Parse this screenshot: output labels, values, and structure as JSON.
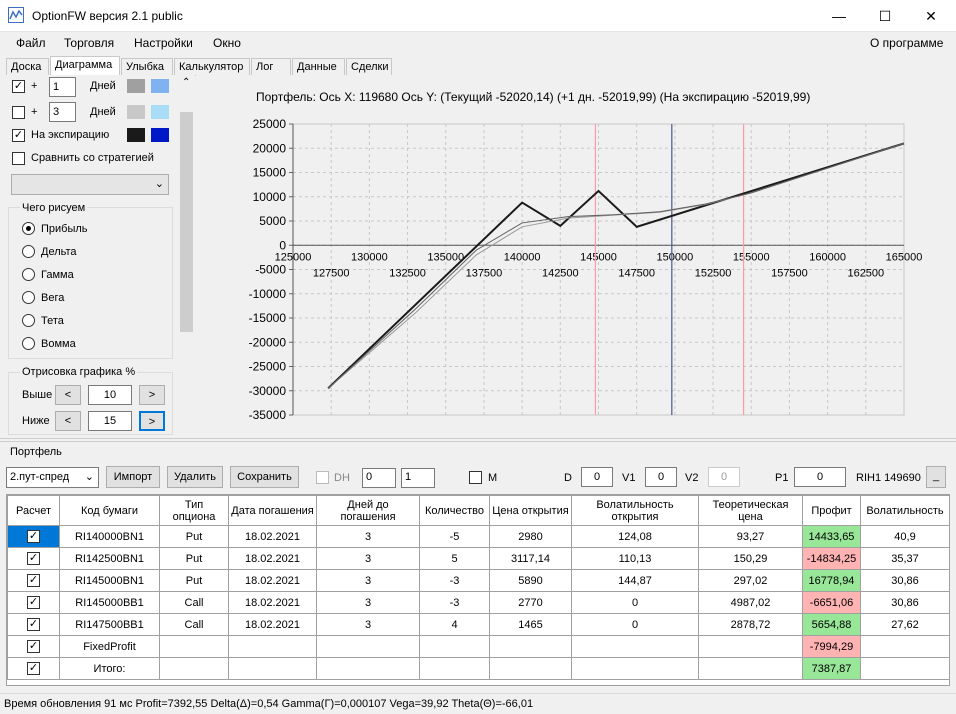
{
  "window": {
    "title": "OptionFW версия 2.1 public",
    "minimize": "—",
    "maximize": "☐",
    "close": "✕"
  },
  "menu": {
    "items": [
      "Файл",
      "Торговля",
      "Настройки",
      "Окно"
    ],
    "about": "О программе"
  },
  "tabs": [
    "Доска",
    "Диаграмма",
    "Улыбка",
    "Калькулятор",
    "Лог",
    "Данные",
    "Сделки"
  ],
  "active_tab": "Диаграмма",
  "left": {
    "row1": {
      "checked": true,
      "plus": "+",
      "days": "1",
      "days_label": "Дней",
      "colors": [
        "#a0a0a0",
        "#7eb2f0"
      ]
    },
    "row2": {
      "checked": false,
      "plus": "+",
      "days": "3",
      "days_label": "Дней",
      "colors": [
        "#c8c8c8",
        "#a8dcf7"
      ]
    },
    "row3": {
      "checked": true,
      "label": "На экспирацию",
      "colors": [
        "#1a1a1a",
        "#0018c8"
      ]
    },
    "compare": {
      "checked": false,
      "label": "Сравнить со стратегией"
    },
    "what_to_draw": {
      "title": "Чего рисуем",
      "options": [
        "Прибыль",
        "Дельта",
        "Гамма",
        "Вега",
        "Тета",
        "Вомма"
      ],
      "selected": "Прибыль"
    },
    "render": {
      "title": "Отрисовка графика %",
      "above_label": "Выше",
      "above_value": "10",
      "below_label": "Ниже",
      "below_value": "15"
    }
  },
  "chart": {
    "header": "Портфель:  Ось X:  119680  Ось Y:   (Текущий -52020,14)   (+1 дн.  -52019,99)   (На экспирацию -52019,99)"
  },
  "chart_data": {
    "type": "line",
    "y_ticks": [
      "25000",
      "20000",
      "15000",
      "10000",
      "5000",
      "0",
      "-5000",
      "-10000",
      "-15000",
      "-20000",
      "-25000",
      "-30000",
      "-35000"
    ],
    "x_ticks_top": [
      "125000",
      "130000",
      "135000",
      "140000",
      "145000",
      "150000",
      "155000",
      "160000",
      "165000"
    ],
    "x_ticks_bottom": [
      "127500",
      "132500",
      "137500",
      "142500",
      "147500",
      "152500",
      "157500",
      "162500"
    ],
    "xlim": [
      125000,
      165000
    ],
    "ylim": [
      -35000,
      25000
    ],
    "grid": true,
    "vlines": [
      {
        "x": 144800,
        "color": "#ff9aa8"
      },
      {
        "x": 149800,
        "color": "#4a5a8a"
      },
      {
        "x": 154500,
        "color": "#ff9aa8"
      }
    ],
    "series": [
      {
        "color": "#1a1a1a",
        "width": 2,
        "x": [
          127300,
          140000,
          142500,
          145000,
          147500,
          165000
        ],
        "y": [
          -29500,
          8800,
          4000,
          11200,
          3800,
          21000
        ]
      },
      {
        "color": "#9a9a9a",
        "width": 1,
        "x": [
          127300,
          133000,
          137000,
          140000,
          143000,
          146000,
          149000,
          152000,
          155000,
          165000
        ],
        "y": [
          -29500,
          -14000,
          -2000,
          3800,
          5600,
          6200,
          6800,
          8400,
          10800,
          21000
        ]
      },
      {
        "color": "#606060",
        "width": 1,
        "x": [
          127300,
          133000,
          137000,
          140000,
          143000,
          146000,
          149000,
          152000,
          155000,
          165000
        ],
        "y": [
          -29500,
          -13200,
          -1000,
          4600,
          5900,
          6300,
          6900,
          8500,
          10800,
          21000
        ]
      }
    ]
  },
  "portfolio": {
    "label": "Портфель",
    "strategy": "2.пут-спред",
    "import": "Импорт",
    "delete": "Удалить",
    "save": "Сохранить",
    "dh_label": "DH",
    "dh1": "0",
    "dh2": "1",
    "m_label": "M",
    "d_label": "D",
    "d_value": "0",
    "v1_label": "V1",
    "v1_value": "0",
    "v2_label": "V2",
    "v2_value": "0",
    "p1_label": "P1",
    "p1_value": "0",
    "instrument": "RIH1 149690",
    "underscore": "_"
  },
  "table": {
    "headers": [
      "Расчет",
      "Код бумаги",
      "Тип опциона",
      "Дата погашения",
      "Дней до погашения",
      "Количество",
      "Цена открытия",
      "Волатильность открытия",
      "Теоретическая цена",
      "Профит",
      "Волатильность"
    ],
    "rows": [
      {
        "code": "RI140000BN1",
        "type": "Put",
        "date": "18.02.2021",
        "days": "3",
        "qty": "-5",
        "price": "2980",
        "vol_open": "124,08",
        "theo": "93,27",
        "profit": "14433,65",
        "profit_color": "green",
        "vol": "40,9",
        "selected": true
      },
      {
        "code": "RI142500BN1",
        "type": "Put",
        "date": "18.02.2021",
        "days": "3",
        "qty": "5",
        "price": "3117,14",
        "vol_open": "110,13",
        "theo": "150,29",
        "profit": "-14834,25",
        "profit_color": "red",
        "vol": "35,37"
      },
      {
        "code": "RI145000BN1",
        "type": "Put",
        "date": "18.02.2021",
        "days": "3",
        "qty": "-3",
        "price": "5890",
        "vol_open": "144,87",
        "theo": "297,02",
        "profit": "16778,94",
        "profit_color": "green",
        "vol": "30,86"
      },
      {
        "code": "RI145000BB1",
        "type": "Call",
        "date": "18.02.2021",
        "days": "3",
        "qty": "-3",
        "price": "2770",
        "vol_open": "0",
        "theo": "4987,02",
        "profit": "-6651,06",
        "profit_color": "red",
        "vol": "30,86"
      },
      {
        "code": "RI147500BB1",
        "type": "Call",
        "date": "18.02.2021",
        "days": "3",
        "qty": "4",
        "price": "1465",
        "vol_open": "0",
        "theo": "2878,72",
        "profit": "5654,88",
        "profit_color": "green",
        "vol": "27,62"
      },
      {
        "code": "FixedProfit",
        "type": "",
        "date": "",
        "days": "",
        "qty": "",
        "price": "",
        "vol_open": "",
        "theo": "",
        "profit": "-7994,29",
        "profit_color": "red",
        "vol": ""
      },
      {
        "code": "Итого:",
        "type": "",
        "date": "",
        "days": "",
        "qty": "",
        "price": "",
        "vol_open": "",
        "theo": "",
        "profit": "7387,87",
        "profit_color": "green",
        "vol": ""
      }
    ]
  },
  "status": "Время обновления 91 мс  Profit=7392,55 Delta(Δ)=0,54 Gamma(Γ)=0,000107 Vega=39,92 Theta(Θ)=-66,01"
}
